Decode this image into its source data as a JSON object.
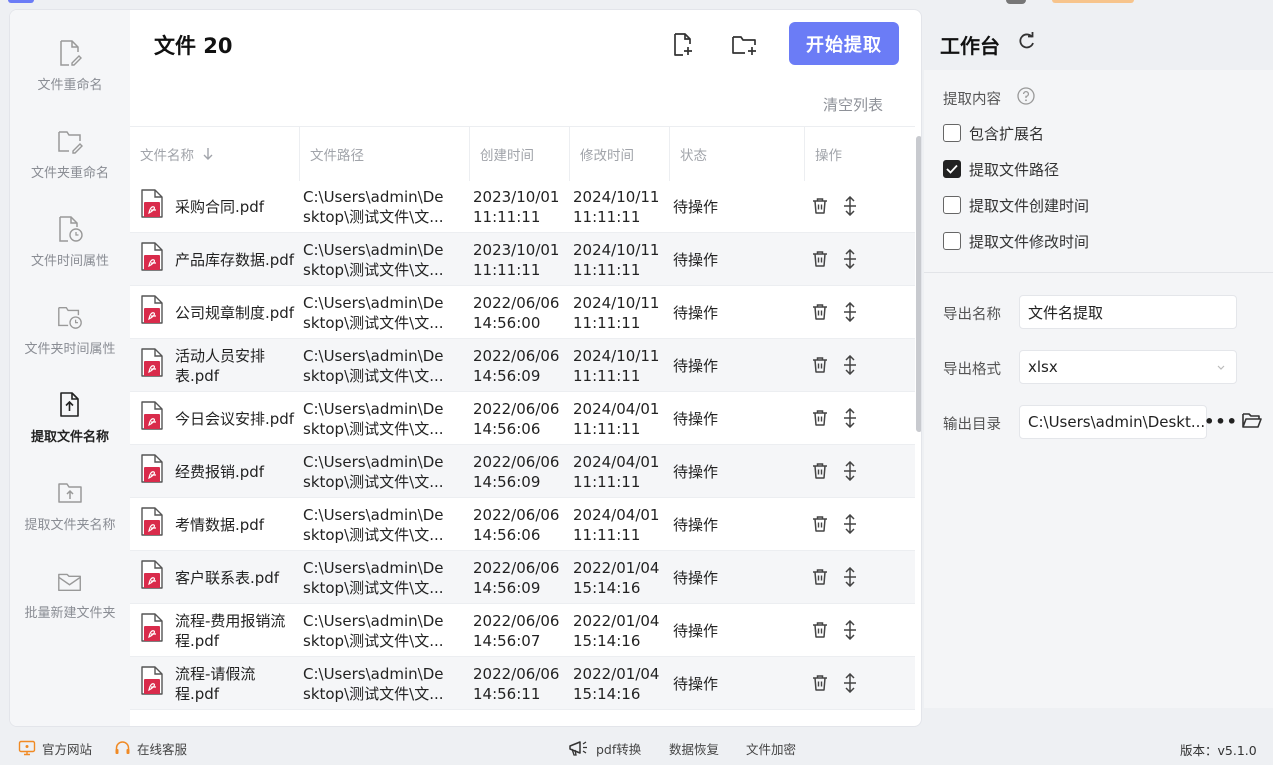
{
  "sidebar": {
    "items": [
      {
        "label": "文件重命名",
        "icon": "file-edit-icon"
      },
      {
        "label": "文件夹重命名",
        "icon": "folder-edit-icon"
      },
      {
        "label": "文件时间属性",
        "icon": "file-clock-icon"
      },
      {
        "label": "文件夹时间属性",
        "icon": "folder-clock-icon"
      },
      {
        "label": "提取文件名称",
        "icon": "file-upload-icon",
        "active": true
      },
      {
        "label": "提取文件夹名称",
        "icon": "folder-upload-icon"
      },
      {
        "label": "批量新建文件夹",
        "icon": "envelope-folder-icon"
      }
    ]
  },
  "main": {
    "title": "文件 20",
    "start_button": "开始提取",
    "clear_list": "清空列表",
    "columns": [
      "文件名称",
      "文件路径",
      "创建时间",
      "修改时间",
      "状态",
      "操作"
    ],
    "rows": [
      {
        "name": "采购合同.pdf",
        "path": "C:\\Users\\admin\\De\nsktop\\测试文件\\文...",
        "ctime": "2023/10/01\n11:11:11",
        "mtime": "2024/10/11\n11:11:11",
        "status": "待操作"
      },
      {
        "name": "产品库存数据.pdf",
        "path": "C:\\Users\\admin\\De\nsktop\\测试文件\\文...",
        "ctime": "2023/10/01\n11:11:11",
        "mtime": "2024/10/11\n11:11:11",
        "status": "待操作"
      },
      {
        "name": "公司规章制度.pdf",
        "path": "C:\\Users\\admin\\De\nsktop\\测试文件\\文...",
        "ctime": "2022/06/06\n14:56:00",
        "mtime": "2024/10/11\n11:11:11",
        "status": "待操作"
      },
      {
        "name": "活动人员安排表.pdf",
        "path": "C:\\Users\\admin\\De\nsktop\\测试文件\\文...",
        "ctime": "2022/06/06\n14:56:09",
        "mtime": "2024/10/11\n11:11:11",
        "status": "待操作"
      },
      {
        "name": "今日会议安排.pdf",
        "path": "C:\\Users\\admin\\De\nsktop\\测试文件\\文...",
        "ctime": "2022/06/06\n14:56:06",
        "mtime": "2024/04/01\n11:11:11",
        "status": "待操作"
      },
      {
        "name": "经费报销.pdf",
        "path": "C:\\Users\\admin\\De\nsktop\\测试文件\\文...",
        "ctime": "2022/06/06\n14:56:09",
        "mtime": "2024/04/01\n11:11:11",
        "status": "待操作"
      },
      {
        "name": "考情数据.pdf",
        "path": "C:\\Users\\admin\\De\nsktop\\测试文件\\文...",
        "ctime": "2022/06/06\n14:56:06",
        "mtime": "2024/04/01\n11:11:11",
        "status": "待操作"
      },
      {
        "name": "客户联系表.pdf",
        "path": "C:\\Users\\admin\\De\nsktop\\测试文件\\文...",
        "ctime": "2022/06/06\n14:56:09",
        "mtime": "2022/01/04\n15:14:16",
        "status": "待操作"
      },
      {
        "name": "流程-费用报销流程.pdf",
        "path": "C:\\Users\\admin\\De\nsktop\\测试文件\\文...",
        "ctime": "2022/06/06\n14:56:07",
        "mtime": "2022/01/04\n15:14:16",
        "status": "待操作"
      },
      {
        "name": "流程-请假流程.pdf",
        "path": "C:\\Users\\admin\\De\nsktop\\测试文件\\文...",
        "ctime": "2022/06/06\n14:56:11",
        "mtime": "2022/01/04\n15:14:16",
        "status": "待操作"
      }
    ]
  },
  "workbench": {
    "title": "工作台",
    "extract_label": "提取内容",
    "options": [
      {
        "label": "包含扩展名",
        "checked": false
      },
      {
        "label": "提取文件路径",
        "checked": true
      },
      {
        "label": "提取文件创建时间",
        "checked": false
      },
      {
        "label": "提取文件修改时间",
        "checked": false
      }
    ],
    "export_name_label": "导出名称",
    "export_name_value": "文件名提取",
    "export_format_label": "导出格式",
    "export_format_value": "xlsx",
    "output_dir_label": "输出目录",
    "output_dir_value": "C:\\Users\\admin\\Deskt...",
    "more_button": "•••"
  },
  "footer": {
    "website": "官方网站",
    "support": "在线客服",
    "pdf_convert": "pdf转换",
    "data_recovery": "数据恢复",
    "file_encrypt": "文件加密",
    "version": "版本：v5.1.0"
  },
  "colors": {
    "accent": "#6b7cf6",
    "pdf_red": "#d92b4b",
    "footer_orange": "#f08a24"
  }
}
